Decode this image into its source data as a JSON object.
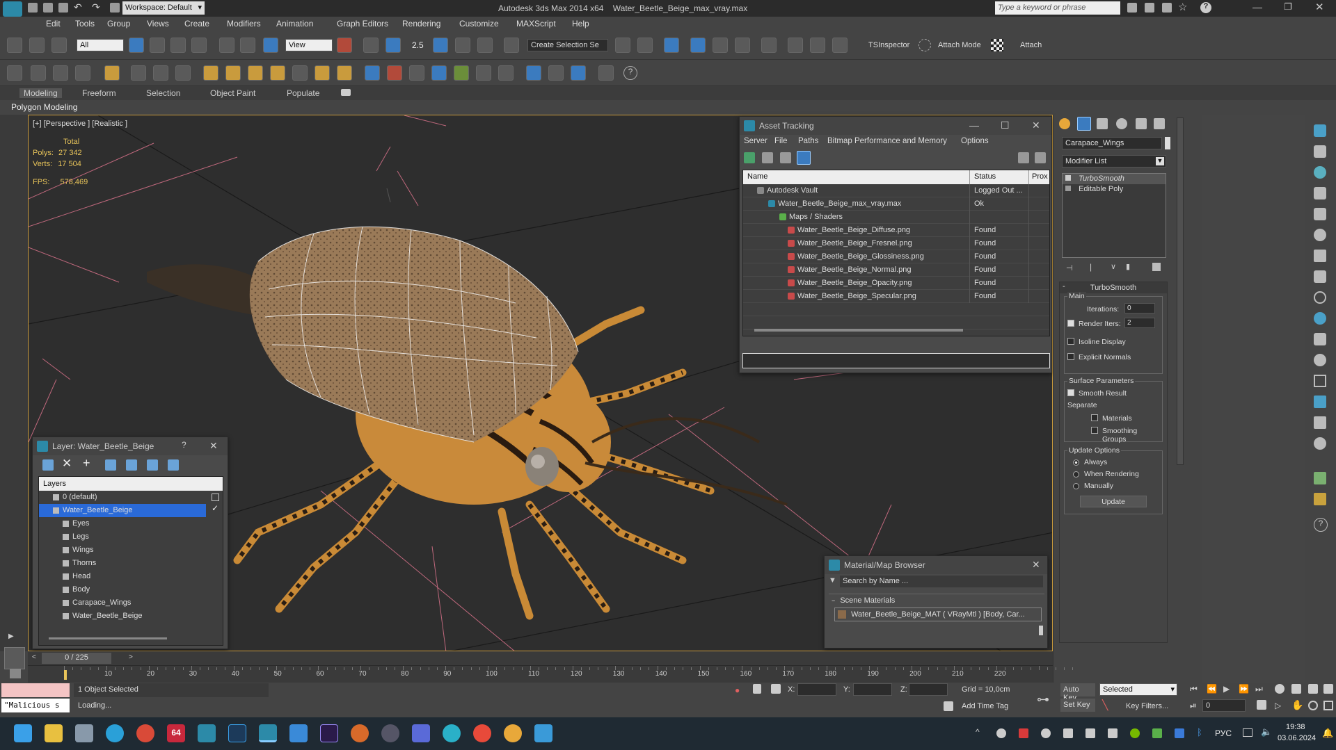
{
  "app": {
    "title": "Autodesk 3ds Max 2014 x64    Water_Beetle_Beige_max_vray.max",
    "workspace": "Workspace: Default",
    "search_placeholder": "Type a keyword or phrase"
  },
  "menu": [
    "Edit",
    "Tools",
    "Group",
    "Views",
    "Create",
    "Modifiers",
    "Animation",
    "Graph Editors",
    "Rendering",
    "Customize",
    "MAXScript",
    "Help"
  ],
  "toolbar": {
    "filter_value": "All",
    "view_value": "View",
    "selection_set": "Create Selection Se",
    "snap_value": "2.5",
    "tsinspector": "TSInspector",
    "attach_mode": "Attach Mode",
    "attach": "Attach"
  },
  "ribbon": {
    "tabs": [
      "Modeling",
      "Freeform",
      "Selection",
      "Object Paint",
      "Populate"
    ],
    "sub": "Polygon Modeling"
  },
  "viewport": {
    "label": "[+] [Perspective ] [Realistic ]",
    "stats_total": "Total",
    "polys_label": "Polys:",
    "polys_value": "27 342",
    "verts_label": "Verts:",
    "verts_value": "17 504",
    "fps_label": "FPS:",
    "fps_value": "578,469"
  },
  "asset_tracking": {
    "title": "Asset Tracking",
    "menu": [
      "Server",
      "File",
      "Paths",
      "Bitmap Performance and Memory",
      "Options"
    ],
    "columns": [
      "Name",
      "Status",
      "Prox"
    ],
    "rows": [
      {
        "name": "Autodesk Vault",
        "status": "Logged Out ...",
        "indent": 0
      },
      {
        "name": "Water_Beetle_Beige_max_vray.max",
        "status": "Ok",
        "indent": 1
      },
      {
        "name": "Maps / Shaders",
        "status": "",
        "indent": 2
      },
      {
        "name": "Water_Beetle_Beige_Diffuse.png",
        "status": "Found",
        "indent": 3
      },
      {
        "name": "Water_Beetle_Beige_Fresnel.png",
        "status": "Found",
        "indent": 3
      },
      {
        "name": "Water_Beetle_Beige_Glossiness.png",
        "status": "Found",
        "indent": 3
      },
      {
        "name": "Water_Beetle_Beige_Normal.png",
        "status": "Found",
        "indent": 3
      },
      {
        "name": "Water_Beetle_Beige_Opacity.png",
        "status": "Found",
        "indent": 3
      },
      {
        "name": "Water_Beetle_Beige_Specular.png",
        "status": "Found",
        "indent": 3
      }
    ]
  },
  "layer": {
    "title": "Layer: Water_Beetle_Beige",
    "help": "?",
    "header": "Layers",
    "items": [
      {
        "name": "0 (default)",
        "indent": 0,
        "selected": false
      },
      {
        "name": "Water_Beetle_Beige",
        "indent": 0,
        "selected": true
      },
      {
        "name": "Eyes",
        "indent": 1,
        "selected": false
      },
      {
        "name": "Legs",
        "indent": 1,
        "selected": false
      },
      {
        "name": "Wings",
        "indent": 1,
        "selected": false
      },
      {
        "name": "Thorns",
        "indent": 1,
        "selected": false
      },
      {
        "name": "Head",
        "indent": 1,
        "selected": false
      },
      {
        "name": "Body",
        "indent": 1,
        "selected": false
      },
      {
        "name": "Carapace_Wings",
        "indent": 1,
        "selected": false
      },
      {
        "name": "Water_Beetle_Beige",
        "indent": 1,
        "selected": false
      }
    ]
  },
  "material_browser": {
    "title": "Material/Map Browser",
    "search_placeholder": "Search by Name ...",
    "section": "Scene Materials",
    "item": "Water_Beetle_Beige_MAT ( VRayMtl ) [Body, Car..."
  },
  "command_panel": {
    "object_name": "Carapace_Wings",
    "modifier_list": "Modifier List",
    "stack": [
      "TurboSmooth",
      "Editable Poly"
    ],
    "rollout_title": "TurboSmooth",
    "main_label": "Main",
    "iterations_label": "Iterations:",
    "iterations_value": "0",
    "render_iters_label": "Render Iters:",
    "render_iters_value": "2",
    "isoline": "Isoline Display",
    "explicit_normals": "Explicit Normals",
    "surface_params": "Surface Parameters",
    "smooth_result": "Smooth Result",
    "separate": "Separate",
    "materials": "Materials",
    "smoothing_groups": "Smoothing Groups",
    "update_options": "Update Options",
    "always": "Always",
    "when_rendering": "When Rendering",
    "manually": "Manually",
    "update_button": "Update"
  },
  "timeline": {
    "frame": "0 / 225",
    "ticks": [
      "10",
      "20",
      "30",
      "40",
      "50",
      "60",
      "70",
      "80",
      "90",
      "100",
      "110",
      "120",
      "130",
      "140",
      "150",
      "160",
      "170",
      "180",
      "190",
      "200",
      "210",
      "220"
    ]
  },
  "status": {
    "maxscript": "\"Malicious s",
    "selected": "1 Object Selected",
    "loading": "Loading...",
    "x": "X:",
    "y": "Y:",
    "z": "Z:",
    "grid": "Grid = 10,0cm",
    "add_time_tag": "Add Time Tag",
    "auto_key": "Auto Key",
    "set_key": "Set Key",
    "selected_dropdown": "Selected",
    "key_filters": "Key Filters...",
    "frame_field": "0"
  },
  "taskbar": {
    "lang": "РУС",
    "time": "19:38",
    "date": "03.06.2024",
    "badge": "64"
  }
}
